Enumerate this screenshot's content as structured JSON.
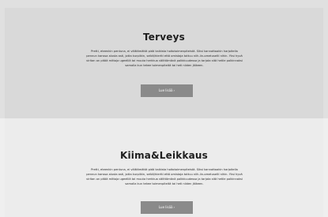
{
  "sections": [
    {
      "title": "Terveys",
      "text": "Pretti, eteenkin pentuna, ei välttämättä pidä kaikista hoitotoimenpiteistä. Siksi kannattaakin harjoitella pennun kanssa alusta asti, jotta kurpiikin, selkä/hiertti että omistaja tottuu niih-iin-ometuseltl nihin. Yksi hyvä viritan on pitää mittoja ugeelliä tai muuta herkkua välittömänä palkkiuudessa ja tarjota sitä hetile palkinnaksi samalla kun tekee toimenpiteitä tai heti niiden jälkeen.",
      "button_label": "Lue lisää",
      "button_icon": "arrow-right-icon"
    },
    {
      "title": "Kiima&Leikkaus",
      "text": "Pretti, eteenkin pentuna, ei välttämättä pidä kaikista hoitotoimenpiteistä. Siksi kannattaakin harjoitella pennun kanssa alusta asti, jotta kurpiikin, selkä/hiertti että omistaja tottuu niih-iin-ometuseltl nihin. Yksi hyvä viritan on pitää mittoja ugeelliä tai muuta herkkua välittömänä palkkiuudessa ja tarjota sitä hetile palkinnaksi samalla kun tekee toimenpiteitä tai heti niiden jälkeen.",
      "button_label": "Lue lisää",
      "button_icon": "arrow-right-icon"
    }
  ],
  "colors": {
    "section_1_bg": "#d9d9d9",
    "section_2_bg": "#ececec",
    "button_bg": "#8a8a8a",
    "title_color": "#1e1e1e"
  }
}
